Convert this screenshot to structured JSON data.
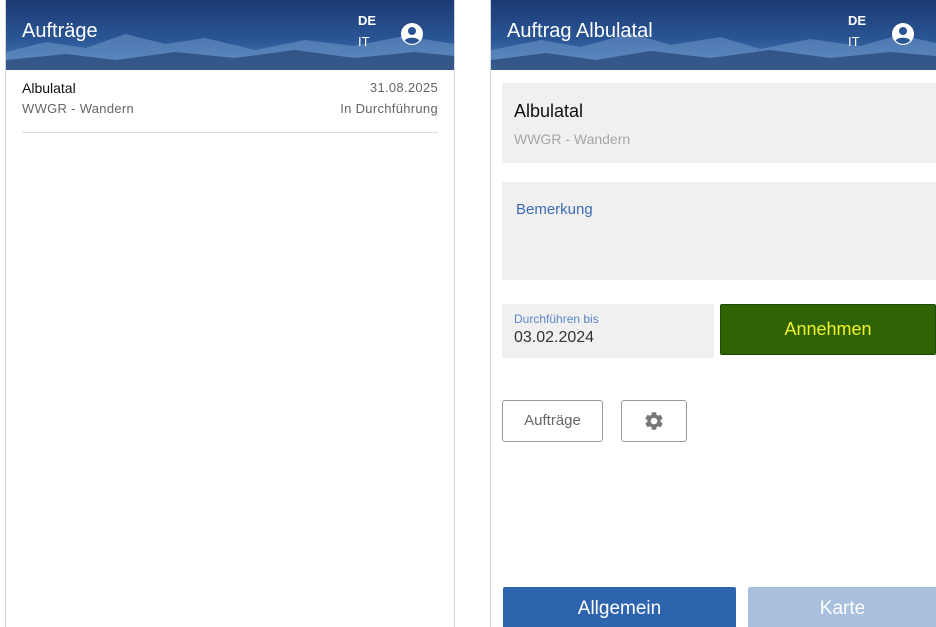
{
  "list_screen": {
    "header": {
      "title": "Aufträge",
      "lang_de": "DE",
      "lang_it": "IT"
    },
    "orders": [
      {
        "name": "Albulatal",
        "category": "WWGR - Wandern",
        "date": "31.08.2025",
        "status": "In Durchführung"
      }
    ]
  },
  "detail_screen": {
    "header": {
      "title": "Auftrag Albulatal",
      "lang_de": "DE",
      "lang_it": "IT"
    },
    "order_title": "Albulatal",
    "order_category": "WWGR - Wandern",
    "remark_label": "Bemerkung",
    "due_label": "Durchführen bis",
    "due_value": "03.02.2024",
    "accept_label": "Annehmen",
    "orders_button": "Aufträge",
    "tabs": {
      "general": "Allgemein",
      "map": "Karte"
    }
  },
  "colors": {
    "header_blue": "#2a5594",
    "accept_bg": "#2e6203",
    "accept_text": "#f2f22a",
    "tab_active": "#2d64ad",
    "tab_inactive": "#a8c0dd",
    "link_blue": "#3d6cb4"
  },
  "icons": {
    "user": "account-circle-icon",
    "settings": "gear-icon"
  }
}
